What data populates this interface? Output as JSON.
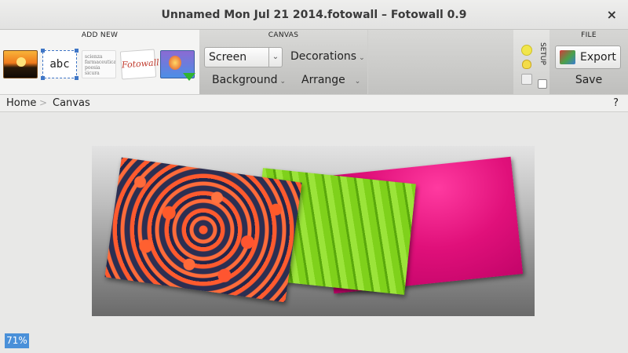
{
  "window": {
    "title": "Unnamed Mon Jul 21 2014.fotowall – Fotowall 0.9",
    "close_glyph": "×"
  },
  "toolbar": {
    "add_new": {
      "label": "ADD NEW",
      "text_tool": "abc",
      "wordcloud_text": "scienza farmaceutica poesia sicura",
      "fotowall_text": "Fotowall"
    },
    "canvas": {
      "label": "CANVAS",
      "screen_combo": "Screen",
      "decorations": "Decorations",
      "background": "Background",
      "arrange": "Arrange"
    },
    "setup": {
      "label": "SETUP"
    },
    "file": {
      "label": "FILE",
      "export": "Export",
      "save": "Save"
    }
  },
  "breadcrumb": {
    "home": "Home",
    "sep": ">",
    "canvas": "Canvas",
    "help": "?"
  },
  "status": {
    "zoom": "71%"
  },
  "icons": {
    "chevron": "⌄"
  }
}
